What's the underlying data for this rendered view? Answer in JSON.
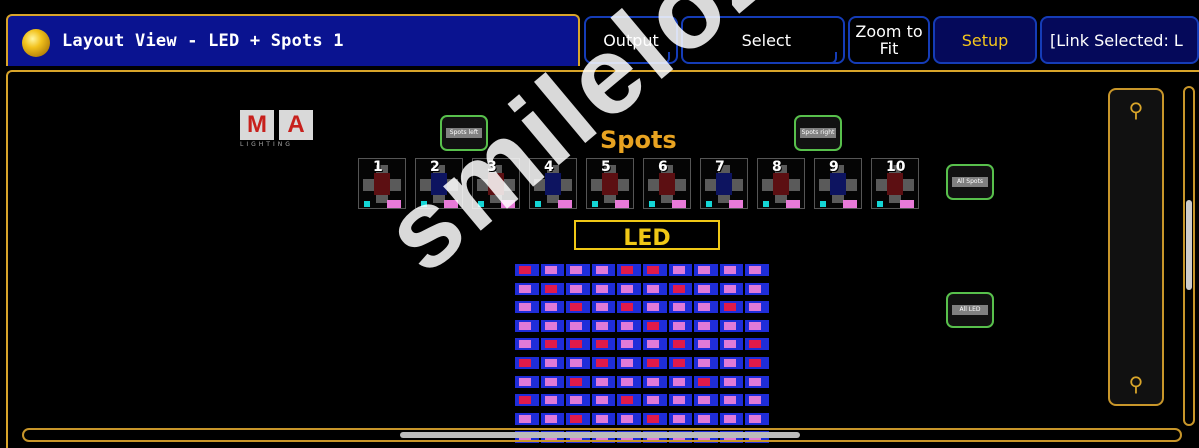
{
  "window": {
    "title": "Layout View - LED + Spots 1"
  },
  "toolbar": {
    "output": "Output",
    "select": "Select",
    "zoom_line1": "Zoom to",
    "zoom_line2": "Fit",
    "setup": "Setup",
    "link": "[Link Selected: L"
  },
  "logo": {
    "letters": [
      "M",
      "A"
    ],
    "sub": "LIGHTING"
  },
  "groups": {
    "spots_left": "Spots left",
    "spots_right": "Spots right",
    "all_spots": "All Spots",
    "all_led": "All LED"
  },
  "labels": {
    "spots": "Spots",
    "led": "LED"
  },
  "spots": [
    {
      "num": "1",
      "color": "#5c0f12"
    },
    {
      "num": "2",
      "color": "#0d1460"
    },
    {
      "num": "3",
      "color": "#5c0f12"
    },
    {
      "num": "4",
      "color": "#0d1460"
    },
    {
      "num": "5",
      "color": "#5c0f12"
    },
    {
      "num": "6",
      "color": "#5c0f12"
    },
    {
      "num": "7",
      "color": "#0d1460"
    },
    {
      "num": "8",
      "color": "#5c0f12"
    },
    {
      "num": "9",
      "color": "#0d1460"
    },
    {
      "num": "10",
      "color": "#5c0f12"
    }
  ],
  "led_rows": [
    [
      "#e01a4a",
      "#e07ad8",
      "#e07ad8",
      "#e07ad8",
      "#e01a4a",
      "#e01a4a",
      "#e07ad8",
      "#e07ad8",
      "#e07ad8",
      "#e07ad8"
    ],
    [
      "#e07ad8",
      "#e01a4a",
      "#e07ad8",
      "#e07ad8",
      "#e07ad8",
      "#e07ad8",
      "#e01a4a",
      "#e07ad8",
      "#e07ad8",
      "#e07ad8"
    ],
    [
      "#e07ad8",
      "#e07ad8",
      "#e01a4a",
      "#e07ad8",
      "#e01a4a",
      "#e07ad8",
      "#e07ad8",
      "#e07ad8",
      "#e01a4a",
      "#e07ad8"
    ],
    [
      "#e07ad8",
      "#e07ad8",
      "#e07ad8",
      "#e07ad8",
      "#e07ad8",
      "#e01a4a",
      "#e07ad8",
      "#e07ad8",
      "#e07ad8",
      "#e07ad8"
    ],
    [
      "#e07ad8",
      "#e01a4a",
      "#e01a4a",
      "#e01a4a",
      "#e07ad8",
      "#e07ad8",
      "#e01a4a",
      "#e07ad8",
      "#e07ad8",
      "#e01a4a"
    ],
    [
      "#e01a4a",
      "#e07ad8",
      "#e07ad8",
      "#e01a4a",
      "#e07ad8",
      "#e01a4a",
      "#e01a4a",
      "#e07ad8",
      "#e07ad8",
      "#e01a4a"
    ],
    [
      "#e07ad8",
      "#e07ad8",
      "#e01a4a",
      "#e07ad8",
      "#e07ad8",
      "#e07ad8",
      "#e07ad8",
      "#e01a4a",
      "#e07ad8",
      "#e07ad8"
    ],
    [
      "#e01a4a",
      "#e07ad8",
      "#e07ad8",
      "#e07ad8",
      "#e01a4a",
      "#e07ad8",
      "#e07ad8",
      "#e07ad8",
      "#e07ad8",
      "#e07ad8"
    ],
    [
      "#e07ad8",
      "#e07ad8",
      "#e01a4a",
      "#e07ad8",
      "#e07ad8",
      "#e01a4a",
      "#e07ad8",
      "#e07ad8",
      "#e07ad8",
      "#e07ad8"
    ],
    [
      "#e07ad8",
      "#e07ad8",
      "#e07ad8",
      "#e07ad8",
      "#e07ad8",
      "#e07ad8",
      "#e07ad8",
      "#e07ad8",
      "#e07ad8",
      "#e07ad8"
    ]
  ],
  "watermark": "smileloZ",
  "colors": {
    "accent": "#d9a52a",
    "title_bg": "#0a1390",
    "button_border": "#153cb7",
    "group_border": "#58c04c",
    "setup_text": "#f4c61d"
  }
}
